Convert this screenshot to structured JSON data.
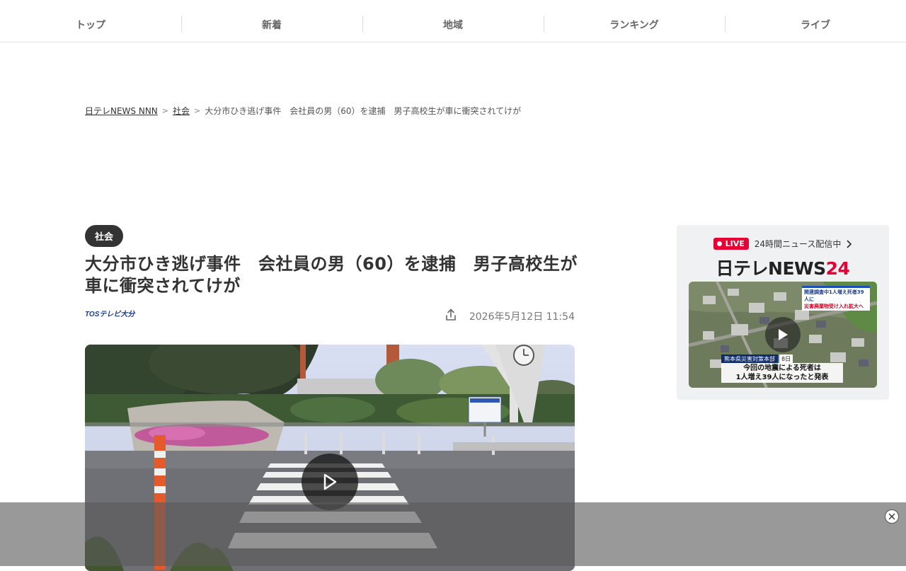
{
  "nav": {
    "items": [
      {
        "label": "トップ"
      },
      {
        "label": "新着"
      },
      {
        "label": "地域"
      },
      {
        "label": "ランキング"
      },
      {
        "label": "ライブ"
      }
    ]
  },
  "breadcrumb": {
    "home": "日テレNEWS NNN",
    "category": "社会",
    "current": "大分市ひき逃げ事件　会社員の男（60）を逮捕　男子高校生が車に衝突されてけが",
    "separator": ">"
  },
  "article": {
    "category": "社会",
    "title_line1": "大分市ひき逃げ事件　会社員の男（60）を逮捕　男子高校生が",
    "title_line2": "車に衝突されてけが",
    "source": "TOSテレビ大分",
    "date": "2026年5月12日 11:54"
  },
  "sidebar": {
    "live_badge": "LIVE",
    "live_text": "24時間ニュース配信中",
    "brand_main": "日テレNEWS",
    "brand_24": "24",
    "thumb_caption_top_1": "関連調査中1人増え死者39人に",
    "thumb_caption_top_2": "災害廃棄物受け入れ拡大へ",
    "thumb_caption_dept": "熊本県災害対策本部",
    "thumb_caption_date": "8日",
    "thumb_caption_main_1": "今回の地震による死者は",
    "thumb_caption_main_2": "1人増え39人になったと発表"
  },
  "colors": {
    "live_red": "#e60033",
    "badge_dark": "#333333"
  }
}
